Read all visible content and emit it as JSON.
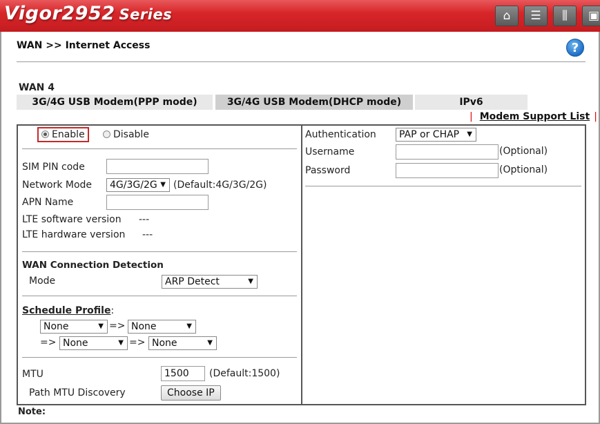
{
  "header": {
    "brand": "Vigor2952",
    "series": "Series",
    "icons": [
      "home-icon",
      "layout-icon",
      "sliders-icon",
      "save-icon"
    ]
  },
  "breadcrumb": "WAN >> Internet Access",
  "wan_title": "WAN 4",
  "tabs": [
    {
      "label": "3G/4G USB Modem(PPP mode)",
      "active": false
    },
    {
      "label": "3G/4G USB Modem(DHCP mode)",
      "active": true
    },
    {
      "label": "IPv6",
      "active": false
    }
  ],
  "modem_link": "Modem Support List",
  "left": {
    "enable_label": "Enable",
    "disable_label": "Disable",
    "enable_selected": true,
    "sim_pin_label": "SIM PIN code",
    "sim_pin_value": "",
    "network_mode_label": "Network Mode",
    "network_mode_value": "4G/3G/2G",
    "network_mode_default": "(Default:4G/3G/2G)",
    "apn_label": "APN Name",
    "apn_value": "",
    "lte_sw_label": "LTE software version",
    "lte_sw_value": "---",
    "lte_hw_label": "LTE hardware version",
    "lte_hw_value": "---",
    "detection_title": "WAN Connection Detection",
    "mode_label": "Mode",
    "mode_value": "ARP Detect",
    "schedule_label": "Schedule Profile",
    "schedule_colon": ":",
    "schedule": [
      "None",
      "None",
      "None",
      "None"
    ],
    "arrow": "=>",
    "mtu_label": "MTU",
    "mtu_value": "1500",
    "mtu_default": "(Default:1500)",
    "path_mtu_label": "Path MTU Discovery",
    "choose_ip_label": "Choose IP"
  },
  "right": {
    "auth_label": "Authentication",
    "auth_value": "PAP or CHAP",
    "username_label": "Username",
    "username_value": "",
    "username_hint": "(Optional)",
    "password_label": "Password",
    "password_value": "",
    "password_hint": "(Optional)"
  },
  "note_label": "Note:"
}
